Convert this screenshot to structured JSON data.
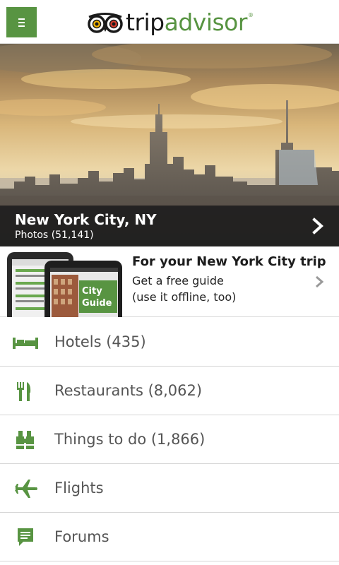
{
  "header": {
    "menu_icon": "menu-icon",
    "logo_part1": "trip",
    "logo_part2": "advisor",
    "logo_mark": "®",
    "brand_color": "#589442"
  },
  "hero": {
    "title": "New York City, NY",
    "photos_label": "Photos",
    "photos_count": "(51,141)",
    "chevron_icon": "chevron-right-icon"
  },
  "promo": {
    "title": "For your New York City trip",
    "line1": "Get a free guide",
    "line2": "(use it offline, too)",
    "phone_badge": "City Guide",
    "chevron_icon": "chevron-right-icon"
  },
  "list": {
    "items": [
      {
        "label": "Hotels (435)",
        "icon": "bed-icon"
      },
      {
        "label": "Restaurants (8,062)",
        "icon": "fork-knife-icon"
      },
      {
        "label": "Things to do (1,866)",
        "icon": "binoculars-icon"
      },
      {
        "label": "Flights",
        "icon": "airplane-icon"
      },
      {
        "label": "Forums",
        "icon": "speech-bubble-icon"
      }
    ]
  }
}
